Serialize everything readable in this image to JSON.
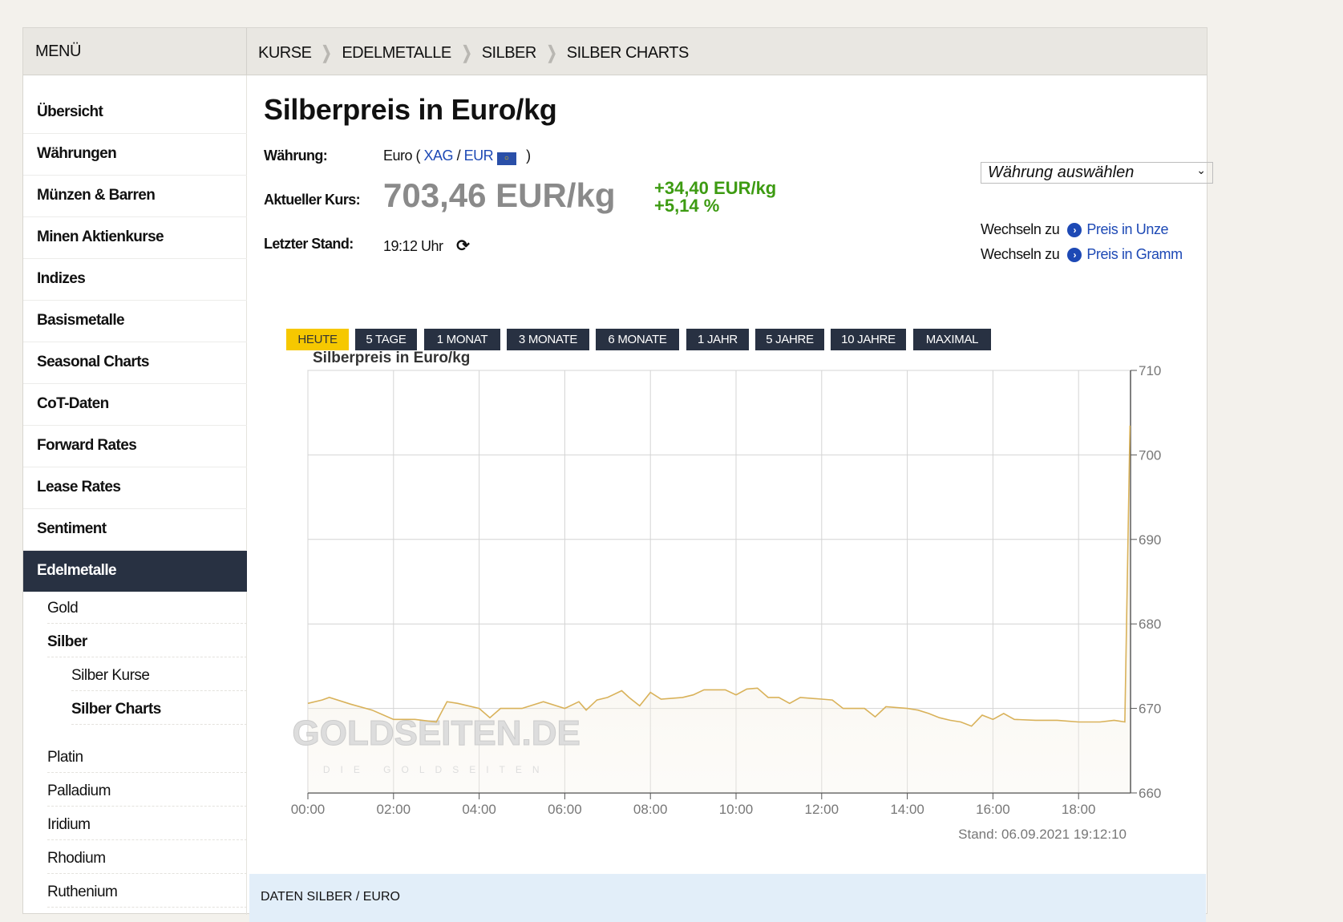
{
  "header": {
    "menu": "MENÜ",
    "breadcrumb": [
      "KURSE",
      "EDELMETALLE",
      "SILBER",
      "SILBER CHARTS"
    ]
  },
  "sidebar": {
    "items": [
      "Übersicht",
      "Währungen",
      "Münzen & Barren",
      "Minen Aktienkurse",
      "Indizes",
      "Basismetalle",
      "Seasonal Charts",
      "CoT-Daten",
      "Forward Rates",
      "Lease Rates",
      "Sentiment",
      "Edelmetalle"
    ],
    "sub": [
      "Gold",
      "Silber",
      "Silber Kurse",
      "Silber Charts",
      "Platin",
      "Palladium",
      "Iridium",
      "Rhodium",
      "Ruthenium"
    ]
  },
  "main": {
    "title": "Silberpreis in Euro/kg",
    "currency_label": "Währung:",
    "currency_value": "Euro (",
    "xag": "XAG",
    "slash": "/",
    "eur": "EUR",
    "close_paren": ")",
    "kurs_label": "Aktueller Kurs:",
    "price": "703,46 EUR/kg",
    "change_abs": "+34,40 EUR/kg",
    "change_pct": "+5,14 %",
    "stand_label": "Letzter Stand:",
    "stand_value": "19:12 Uhr",
    "select": "Währung auswählen",
    "switch": [
      {
        "prefix": "Wechseln zu",
        "link": "Preis in Unze"
      },
      {
        "prefix": "Wechseln zu",
        "link": "Preis in Gramm"
      }
    ],
    "ranges": [
      "HEUTE",
      "5 TAGE",
      "1 MONAT",
      "3 MONATE",
      "6 MONATE",
      "1 JAHR",
      "5 JAHRE",
      "10 JAHRE",
      "MAXIMAL"
    ],
    "band_title": "DATEN SILBER / EURO"
  },
  "colors": {
    "line": "#d9b25a",
    "active": "#f6c800",
    "nav": "#283142",
    "up": "#3d9b12"
  },
  "chart_data": {
    "type": "line",
    "title": "Silberpreis in Euro/kg",
    "ylim": [
      660,
      710
    ],
    "yticks": [
      660,
      670,
      680,
      690,
      700,
      710
    ],
    "xticks": [
      "00:00",
      "02:00",
      "04:00",
      "06:00",
      "08:00",
      "10:00",
      "12:00",
      "14:00",
      "16:00",
      "18:00"
    ],
    "watermark": "GOLDSEITEN.DE",
    "watermark_sub": "DIE GOLDSEITEN",
    "footer": "Stand: 06.09.2021 19:12:10",
    "x": [
      0,
      0.33,
      0.5,
      1,
      1.5,
      2,
      2.5,
      3,
      3.25,
      3.5,
      4,
      4.25,
      4.5,
      5,
      5.5,
      6,
      6.33,
      6.5,
      6.75,
      7,
      7.33,
      7.5,
      7.75,
      8,
      8.25,
      8.75,
      9,
      9.25,
      9.75,
      10,
      10.25,
      10.5,
      10.75,
      11,
      11.25,
      11.5,
      12,
      12.25,
      12.5,
      13,
      13.25,
      13.5,
      14,
      14.25,
      14.5,
      14.75,
      15,
      15.25,
      15.5,
      15.75,
      16,
      16.25,
      16.5,
      17,
      17.5,
      18,
      18.5,
      18.83,
      19.08,
      19.2
    ],
    "y": [
      670.6,
      671,
      671.3,
      670.5,
      669.8,
      668.7,
      668.7,
      668.4,
      670.8,
      670.6,
      670,
      668.9,
      670,
      670,
      670.8,
      670,
      670.8,
      669.8,
      671,
      671.3,
      672.1,
      671.3,
      670.3,
      671.9,
      671.1,
      671.3,
      671.6,
      672.2,
      672.2,
      671.6,
      672.3,
      672.4,
      671.3,
      671.3,
      670.6,
      671.3,
      671.1,
      671,
      670,
      670,
      669,
      670.2,
      670,
      669.8,
      669.4,
      668.9,
      668.6,
      668.4,
      667.9,
      669.2,
      668.7,
      669.4,
      668.7,
      668.6,
      668.6,
      668.4,
      668.4,
      668.6,
      668.4,
      703.46
    ]
  }
}
